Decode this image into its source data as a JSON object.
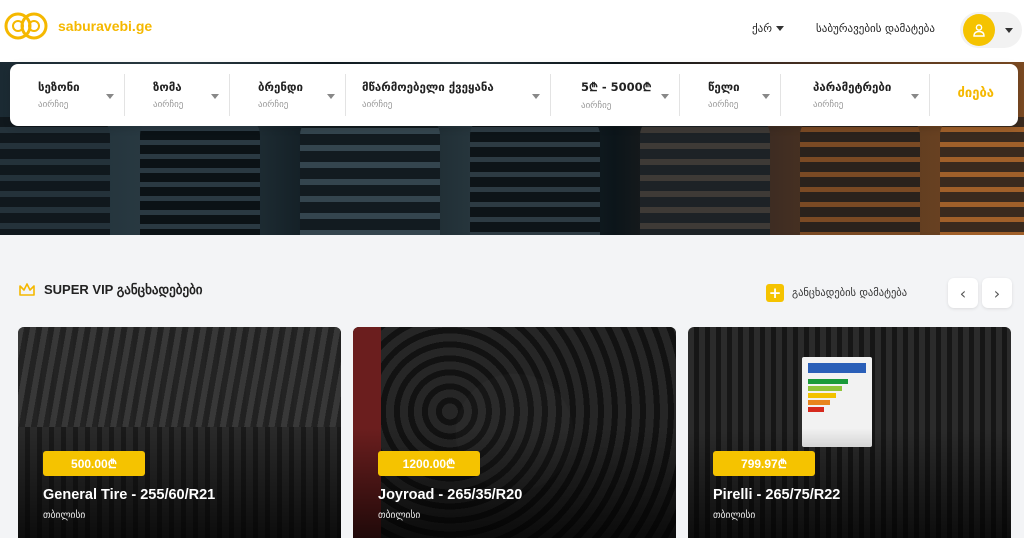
{
  "header": {
    "logo_text": "saburavebi.ge",
    "lang_label": "ქარ",
    "add_tires_label": "საბურავების დამატება"
  },
  "filters": [
    {
      "label": "სეზონი",
      "sub": "აირჩიე"
    },
    {
      "label": "ზომა",
      "sub": "აირჩიე"
    },
    {
      "label": "ბრენდი",
      "sub": "აირჩიე"
    },
    {
      "label": "მწარმოებელი ქვეყანა",
      "sub": "აირჩიე"
    },
    {
      "label": "5₾ - 5000₾",
      "sub": "აირჩიე"
    },
    {
      "label": "წელი",
      "sub": "აირჩიე"
    },
    {
      "label": "პარამეტრები",
      "sub": "აირჩიე"
    }
  ],
  "search_label": "ძიება",
  "section": {
    "title": "SUPER VIP განცხადებები",
    "add_label": "განცხადების დამატება",
    "prev_glyph": "‹",
    "next_glyph": "›"
  },
  "cards": [
    {
      "price": "500.00₾",
      "title": "General Tire - 255/60/R21",
      "city": "თბილისი"
    },
    {
      "price": "1200.00₾",
      "title": "Joyroad - 265/35/R20",
      "city": "თბილისი"
    },
    {
      "price": "799.97₾",
      "title": "Pirelli - 265/75/R22",
      "city": "თბილისი"
    }
  ],
  "colors": {
    "accent": "#f5c300",
    "logo": "#f5b800"
  },
  "icons": [
    "logo-tire-icon",
    "chevron-down-icon",
    "user-icon",
    "crown-icon",
    "plus-icon",
    "chevron-left-icon",
    "chevron-right-icon"
  ]
}
